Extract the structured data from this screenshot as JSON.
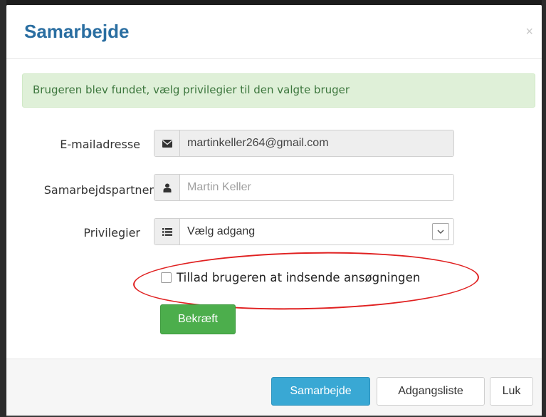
{
  "modal": {
    "title": "Samarbejde",
    "close_symbol": "×",
    "alert_text": "Brugeren blev fundet, vælg privilegier til den valgte bruger"
  },
  "form": {
    "email": {
      "label": "E-mailadresse",
      "value": "martinkeller264@gmail.com",
      "icon": "envelope-icon"
    },
    "partner": {
      "label": "Samarbejdspartner",
      "placeholder": "Martin Keller",
      "icon": "user-icon"
    },
    "privileges": {
      "label": "Privilegier",
      "selected": "Vælg adgang",
      "icon": "list-icon"
    },
    "allow_submit": {
      "label": "Tillad brugeren at indsende ansøgningen",
      "checked": false
    },
    "confirm_label": "Bekræft"
  },
  "footer": {
    "collaborate_label": "Samarbejde",
    "access_list_label": "Adgangsliste",
    "close_label": "Luk"
  },
  "colors": {
    "title": "#2a6ea1",
    "alert_bg": "#dff0d8",
    "alert_text": "#3c763d",
    "confirm": "#4cae4c",
    "primary": "#39a8d4",
    "highlight": "#e02020"
  }
}
